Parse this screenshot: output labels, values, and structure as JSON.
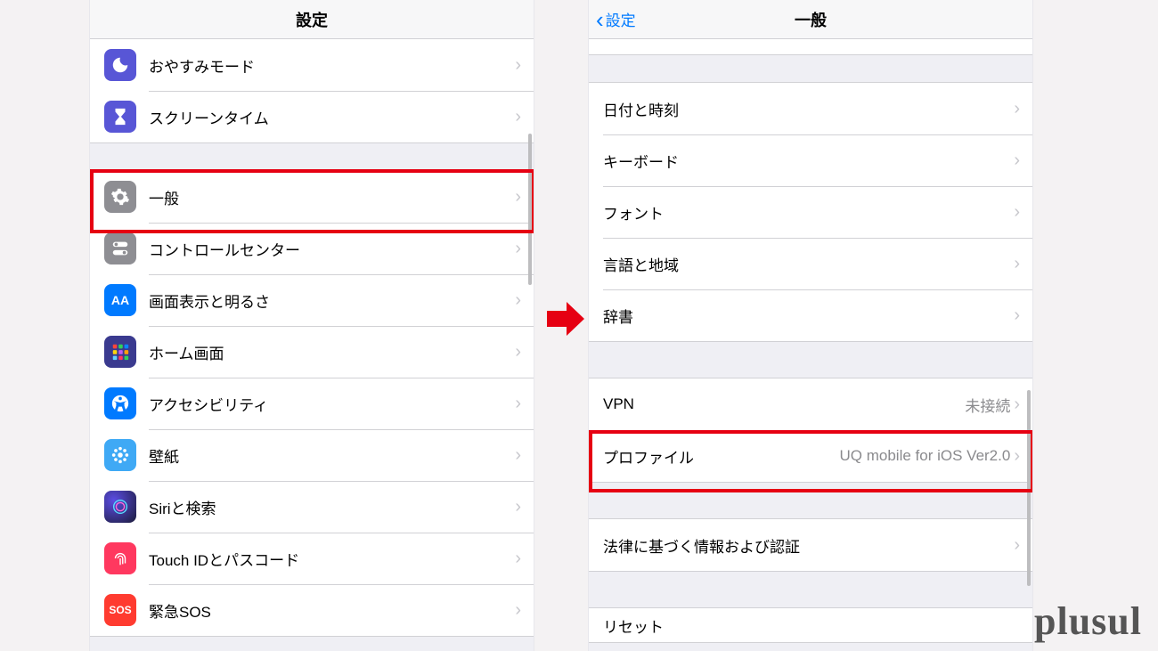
{
  "left": {
    "title": "設定",
    "rows": [
      {
        "icon": "moon",
        "bg": "bg-purple",
        "label": "おやすみモード"
      },
      {
        "icon": "hourglass",
        "bg": "bg-hourglass",
        "label": "スクリーンタイム"
      }
    ],
    "group2": [
      {
        "icon": "gear",
        "bg": "bg-gray",
        "label": "一般",
        "highlight": true
      },
      {
        "icon": "toggles",
        "bg": "bg-gray",
        "label": "コントロールセンター"
      },
      {
        "icon": "AA",
        "bg": "bg-blue",
        "label": "画面表示と明るさ"
      },
      {
        "icon": "grid",
        "bg": "bg-purple",
        "label": "ホーム画面"
      },
      {
        "icon": "person",
        "bg": "bg-blue",
        "label": "アクセシビリティ"
      },
      {
        "icon": "flower",
        "bg": "bg-cyan",
        "label": "壁紙"
      },
      {
        "icon": "siri",
        "bg": "bg-siri",
        "label": "Siriと検索"
      },
      {
        "icon": "touchid",
        "bg": "bg-touch",
        "label": "Touch IDとパスコード"
      },
      {
        "icon": "sos",
        "bg": "bg-redsos",
        "label": "緊急SOS"
      }
    ]
  },
  "right": {
    "title": "一般",
    "back": "設定",
    "group1_partial": "",
    "group2": [
      {
        "label": "日付と時刻"
      },
      {
        "label": "キーボード"
      },
      {
        "label": "フォント"
      },
      {
        "label": "言語と地域"
      },
      {
        "label": "辞書"
      }
    ],
    "group3": [
      {
        "label": "VPN",
        "value": "未接続"
      },
      {
        "label": "プロファイル",
        "value": "UQ mobile for iOS Ver2.0",
        "highlight": true
      }
    ],
    "group4": [
      {
        "label": "法律に基づく情報および認証"
      }
    ],
    "group5_partial": "リセット"
  },
  "watermark": "plusul"
}
